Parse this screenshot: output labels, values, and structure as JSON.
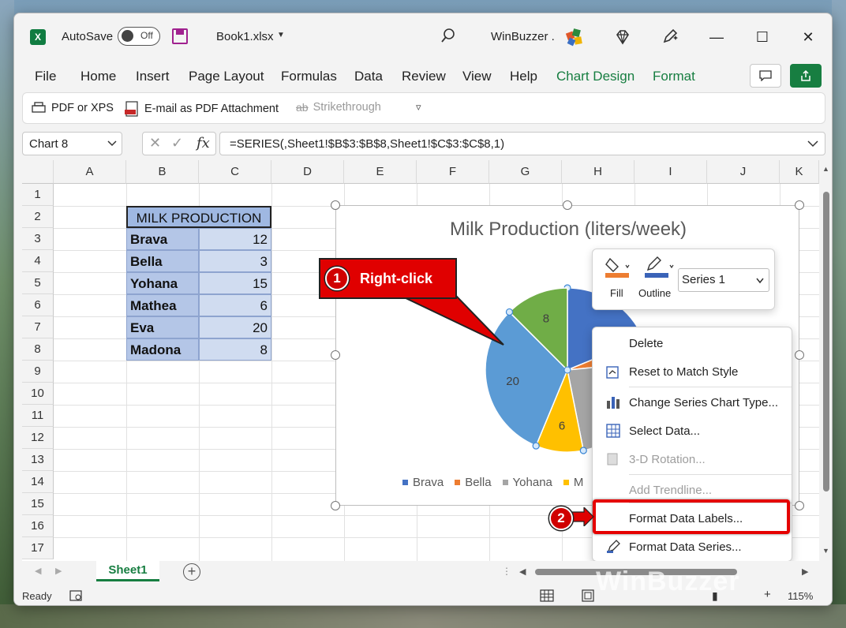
{
  "titlebar": {
    "autosave_label": "AutoSave",
    "autosave_state": "Off",
    "filename": "Book1.xlsx",
    "user_name": "WinBuzzer ."
  },
  "menu": {
    "items": [
      "File",
      "Home",
      "Insert",
      "Page Layout",
      "Formulas",
      "Data",
      "Review",
      "View",
      "Help",
      "Chart Design",
      "Format"
    ],
    "accent_color": "#177e41"
  },
  "qat": {
    "pdf_xps": "PDF or XPS",
    "email_pdf": "E-mail as PDF Attachment",
    "strikethrough": "Strikethrough"
  },
  "formula_bar": {
    "name_box": "Chart 8",
    "fx": "fx",
    "formula": "=SERIES(,Sheet1!$B$3:$B$8,Sheet1!$C$3:$C$8,1)"
  },
  "grid": {
    "columns": [
      "A",
      "B",
      "C",
      "D",
      "E",
      "F",
      "G",
      "H",
      "I",
      "J",
      "K"
    ],
    "rows": [
      "1",
      "2",
      "3",
      "4",
      "5",
      "6",
      "7",
      "8",
      "9",
      "10",
      "11",
      "12",
      "13",
      "14",
      "15",
      "16",
      "17"
    ],
    "table_title": "MILK PRODUCTION",
    "table": [
      {
        "name": "Brava",
        "value": "12"
      },
      {
        "name": "Bella",
        "value": "3"
      },
      {
        "name": "Yohana",
        "value": "15"
      },
      {
        "name": "Mathea",
        "value": "6"
      },
      {
        "name": "Eva",
        "value": "20"
      },
      {
        "name": "Madona",
        "value": "8"
      }
    ]
  },
  "chart": {
    "title": "Milk Production (liters/week)",
    "legend": [
      "Brava",
      "Bella",
      "Yohana",
      "M"
    ],
    "visible_labels": {
      "eva": "20",
      "madona": "8",
      "mathea": "6"
    }
  },
  "chart_data": {
    "type": "pie",
    "title": "Milk Production (liters/week)",
    "categories": [
      "Brava",
      "Bella",
      "Yohana",
      "Mathea",
      "Eva",
      "Madona"
    ],
    "values": [
      12,
      3,
      15,
      6,
      20,
      8
    ],
    "colors": [
      "#4472c4",
      "#ed7d31",
      "#a5a5a5",
      "#ffc000",
      "#5b9bd5",
      "#70ad47"
    ],
    "legend_position": "bottom"
  },
  "mini_toolbar": {
    "fill": "Fill",
    "outline": "Outline",
    "series": "Series 1"
  },
  "context_menu": {
    "items": [
      {
        "label": "Delete",
        "disabled": false
      },
      {
        "label": "Reset to Match Style",
        "disabled": false
      },
      {
        "label": "Change Series Chart Type...",
        "disabled": false
      },
      {
        "label": "Select Data...",
        "disabled": false
      },
      {
        "label": "3-D Rotation...",
        "disabled": true
      },
      {
        "label": "Add Trendline...",
        "disabled": true
      },
      {
        "label": "Format Data Labels...",
        "disabled": false
      },
      {
        "label": "Format Data Series...",
        "disabled": false
      }
    ]
  },
  "annotations": {
    "step1_number": "1",
    "step1_text": "Right-click",
    "step2_number": "2",
    "highlight_color": "#e50000"
  },
  "tabs": {
    "sheet": "Sheet1"
  },
  "status": {
    "ready": "Ready",
    "zoom": "115%"
  },
  "watermark": "WinBuzzer"
}
